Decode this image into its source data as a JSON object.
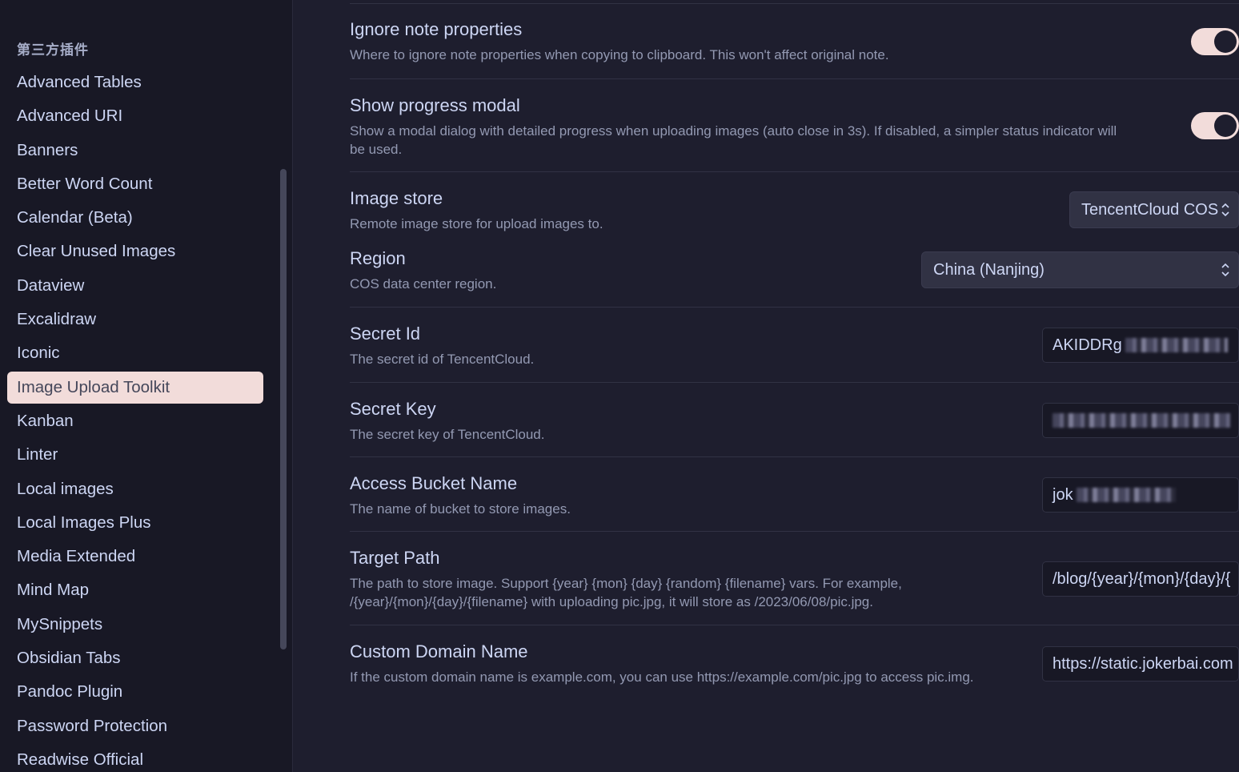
{
  "sidebar": {
    "heading": "第三方插件",
    "items": [
      {
        "label": "Advanced Tables",
        "active": false
      },
      {
        "label": "Advanced URI",
        "active": false
      },
      {
        "label": "Banners",
        "active": false
      },
      {
        "label": "Better Word Count",
        "active": false
      },
      {
        "label": "Calendar (Beta)",
        "active": false
      },
      {
        "label": "Clear Unused Images",
        "active": false
      },
      {
        "label": "Dataview",
        "active": false
      },
      {
        "label": "Excalidraw",
        "active": false
      },
      {
        "label": "Iconic",
        "active": false
      },
      {
        "label": "Image Upload Toolkit",
        "active": true
      },
      {
        "label": "Kanban",
        "active": false
      },
      {
        "label": "Linter",
        "active": false
      },
      {
        "label": "Local images",
        "active": false
      },
      {
        "label": "Local Images Plus",
        "active": false
      },
      {
        "label": "Media Extended",
        "active": false
      },
      {
        "label": "Mind Map",
        "active": false
      },
      {
        "label": "MySnippets",
        "active": false
      },
      {
        "label": "Obsidian Tabs",
        "active": false
      },
      {
        "label": "Pandoc Plugin",
        "active": false
      },
      {
        "label": "Password Protection",
        "active": false
      },
      {
        "label": "Readwise Official",
        "active": false
      }
    ]
  },
  "settings": {
    "ignore_props": {
      "name": "Ignore note properties",
      "desc": "Where to ignore note properties when copying to clipboard. This won't affect original note.",
      "enabled": true
    },
    "progress_modal": {
      "name": "Show progress modal",
      "desc_line1": "Show a modal dialog with detailed progress when uploading images (auto close in 3s). If disabled, a simpler status indicator will",
      "desc_line2": "be used.",
      "enabled": true
    },
    "image_store": {
      "name": "Image store",
      "desc": "Remote image store for upload images to.",
      "value": "TencentCloud COS"
    },
    "region": {
      "name": "Region",
      "desc": "COS data center region.",
      "value": "China (Nanjing)"
    },
    "secret_id": {
      "name": "Secret Id",
      "desc": "The secret id of TencentCloud.",
      "value_visible": "AKIDDRg"
    },
    "secret_key": {
      "name": "Secret Key",
      "desc": "The secret key of TencentCloud."
    },
    "bucket": {
      "name": "Access Bucket Name",
      "desc": "The name of bucket to store images.",
      "value_visible": "jok"
    },
    "target_path": {
      "name": "Target Path",
      "desc_line1": "The path to store image. Support {year} {mon} {day} {random} {filename} vars. For example,",
      "desc_line2": "/{year}/{mon}/{day}/{filename} with uploading pic.jpg, it will store as /2023/06/08/pic.jpg.",
      "value": "/blog/{year}/{mon}/{day}/{"
    },
    "custom_domain": {
      "name": "Custom Domain Name",
      "desc": "If the custom domain name is example.com, you can use https://example.com/pic.jpg to access pic.img.",
      "value": "https://static.jokerbai.com"
    }
  },
  "colors": {
    "accent": "#f2dcda",
    "background": "#1e1e2e",
    "sidebar_background": "#181825",
    "text_muted": "#9399b2"
  }
}
